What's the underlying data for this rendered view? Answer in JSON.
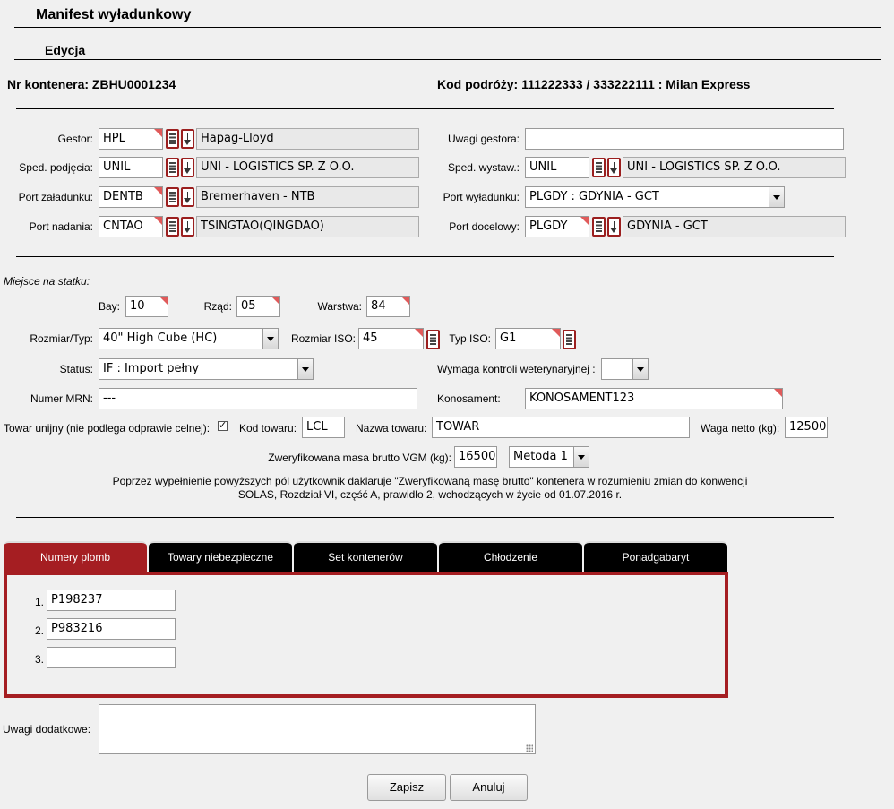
{
  "page": {
    "title": "Manifest wyładunkowy",
    "subtitle": "Edycja",
    "container_label": "Nr kontenera: ZBHU0001234",
    "voyage_label": "Kod podróży: 111222333 / 333222111 : Milan Express"
  },
  "gestor": {
    "label": "Gestor:",
    "code": "HPL",
    "name": "Hapag-Lloyd"
  },
  "uwagi_gestora": {
    "label": "Uwagi gestora:",
    "value": ""
  },
  "sped_podjecia": {
    "label": "Sped. podjęcia:",
    "code": "UNIL",
    "name": "UNI - LOGISTICS SP. Z O.O."
  },
  "sped_wystaw": {
    "label": "Sped. wystaw.:",
    "code": "UNIL",
    "name": "UNI - LOGISTICS SP. Z O.O."
  },
  "port_zaladunku": {
    "label": "Port załadunku:",
    "code": "DENTB",
    "name": "Bremerhaven - NTB"
  },
  "port_wyladunku": {
    "label": "Port wyładunku:",
    "value": "PLGDY : GDYNIA - GCT"
  },
  "port_nadania": {
    "label": "Port nadania:",
    "code": "CNTAO",
    "name": "TSINGTAO(QINGDAO)"
  },
  "port_docelowy": {
    "label": "Port docelowy:",
    "code": "PLGDY",
    "name": "GDYNIA - GCT"
  },
  "stowage": {
    "section_label": "Miejsce na statku:",
    "bay_label": "Bay:",
    "bay": "10",
    "row_label": "Rząd:",
    "row": "05",
    "tier_label": "Warstwa:",
    "tier": "84"
  },
  "size": {
    "label": "Rozmiar/Typ:",
    "value": "40\" High Cube (HC)",
    "iso_label": "Rozmiar ISO:",
    "iso": "45",
    "type_label": "Typ ISO:",
    "type": "G1"
  },
  "status": {
    "label": "Status:",
    "value": "IF : Import pełny"
  },
  "vet": {
    "label": "Wymaga kontroli weterynaryjnej :",
    "value": ""
  },
  "mrn": {
    "label": "Numer MRN:",
    "value": "---"
  },
  "bol": {
    "label": "Konosament:",
    "value": "KONOSAMENT123"
  },
  "goods": {
    "union_label": "Towar unijny (nie podlega odprawie celnej):",
    "union_checked": "✓",
    "code_label": "Kod towaru:",
    "code": "LCL",
    "name_label": "Nazwa towaru:",
    "name": "TOWAR",
    "net_label": "Waga netto (kg):",
    "net": "12500"
  },
  "vgm": {
    "label": "Zweryfikowana masa brutto VGM (kg):",
    "value": "16500",
    "method": "Metoda 1",
    "note_line1": "Poprzez wypełnienie powyższych pól użytkownik daklaruje \"Zweryfikowaną masę brutto\" kontenera w rozumieniu zmian do konwencji",
    "note_line2": "SOLAS, Rozdział VI, część A, prawidło 2, wchodzących w życie od 01.07.2016 r."
  },
  "tabs": [
    {
      "label": "Numery plomb"
    },
    {
      "label": "Towary niebezpieczne"
    },
    {
      "label": "Set kontenerów"
    },
    {
      "label": "Chłodzenie"
    },
    {
      "label": "Ponadgabaryt"
    }
  ],
  "seals": [
    {
      "num": "1.",
      "value": "P198237"
    },
    {
      "num": "2.",
      "value": "P983216"
    },
    {
      "num": "3.",
      "value": ""
    }
  ],
  "remarks": {
    "label": "Uwagi dodatkowe:",
    "value": ""
  },
  "buttons": {
    "save": "Zapisz",
    "cancel": "Anuluj"
  },
  "colors": {
    "accent": "#a51e22",
    "readonly": "#e9e9e9",
    "background": "#f0f0f0"
  }
}
